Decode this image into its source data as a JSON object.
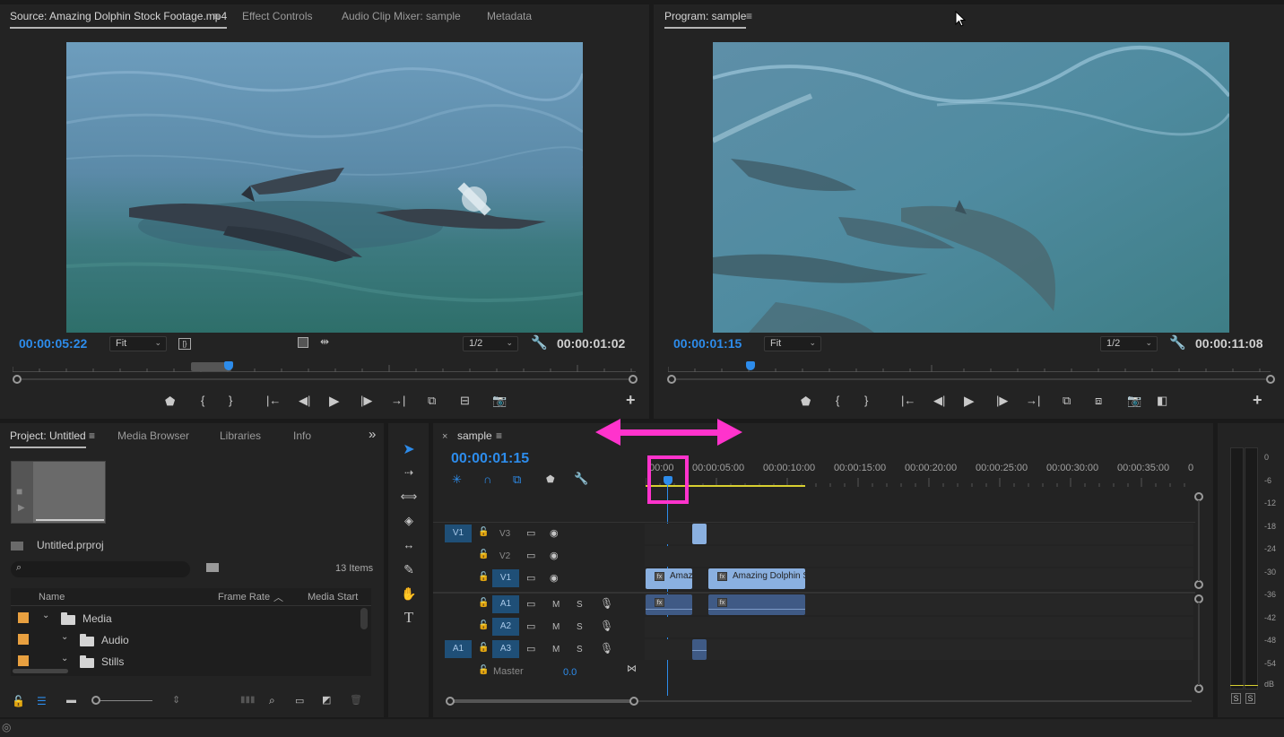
{
  "source": {
    "tabs": [
      "Source: Amazing Dolphin Stock Footage.mp4",
      "Effect Controls",
      "Audio Clip Mixer: sample",
      "Metadata"
    ],
    "menu_glyph": "≡",
    "timecode_in": "00:00:05:22",
    "fit": "Fit",
    "resolution": "1/2",
    "duration": "00:00:01:02",
    "playhead_position": 0.34
  },
  "program": {
    "tab": "Program: sample",
    "menu_glyph": "≡",
    "timecode": "00:00:01:15",
    "fit": "Fit",
    "resolution": "1/2",
    "duration": "00:00:11:08",
    "playhead_position": 0.13
  },
  "project": {
    "tabs": [
      "Project: Untitled",
      "Media Browser",
      "Libraries",
      "Info"
    ],
    "more": "»",
    "file": "Untitled.prproj",
    "search_placeholder": "",
    "items_count": "13 Items",
    "columns": [
      "Name",
      "Frame Rate",
      "Media Start"
    ],
    "rows": [
      {
        "name": "Media",
        "color": "#e8a040"
      },
      {
        "name": "Audio",
        "color": "#e8a040"
      },
      {
        "name": "Stills",
        "color": "#e8a040"
      }
    ]
  },
  "timeline": {
    "close": "×",
    "title": "sample",
    "menu_glyph": "≡",
    "timecode": "00:00:01:15",
    "ruler": [
      "00:00",
      "00:00:05:00",
      "00:00:10:00",
      "00:00:15:00",
      "00:00:20:00",
      "00:00:25:00",
      "00:00:30:00",
      "00:00:35:00",
      "0"
    ],
    "video_tracks": [
      {
        "source": "V1",
        "name": "V3",
        "show_source": true
      },
      {
        "source": "",
        "name": "V2",
        "show_source": false
      },
      {
        "source": "",
        "name": "V1",
        "show_source": false
      }
    ],
    "audio_tracks": [
      {
        "source": "",
        "name": "A1",
        "show_source": false
      },
      {
        "source": "",
        "name": "A2",
        "show_source": false
      },
      {
        "source": "A1",
        "name": "A3",
        "show_source": true
      }
    ],
    "m_label": "M",
    "s_label": "S",
    "master_label": "Master",
    "master_value": "0.0",
    "clip_name_short": "Amaz",
    "clip_name_long": "Amazing Dolphin St",
    "fx_label": "fx"
  },
  "meter": {
    "labels": [
      "0",
      "-6",
      "-12",
      "-18",
      "-24",
      "-30",
      "-36",
      "-42",
      "-48",
      "-54",
      "dB"
    ],
    "solo_left": "S",
    "solo_right": "S"
  },
  "annotation": {
    "color": "#ff33cc"
  },
  "icons": [
    "menu-icon",
    "wrench-icon",
    "play-icon",
    "step-back-icon",
    "step-forward-icon",
    "mark-in-icon",
    "mark-out-icon",
    "marker-icon",
    "camera-icon",
    "plus-icon",
    "selection-tool-icon",
    "hand-tool-icon",
    "type-tool-icon",
    "pen-tool-icon",
    "razor-tool-icon",
    "lock-icon",
    "eye-icon",
    "microphone-icon",
    "folder-icon",
    "search-icon",
    "trash-icon",
    "cursor-icon"
  ]
}
